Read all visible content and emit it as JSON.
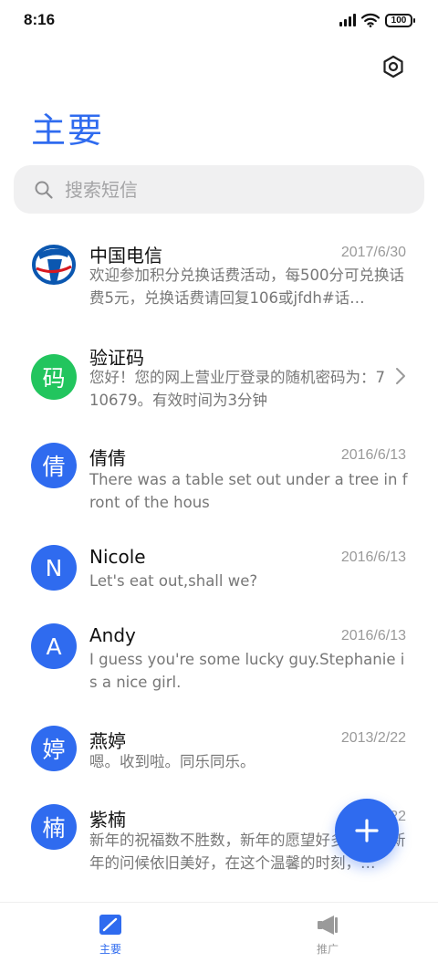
{
  "status_bar": {
    "time": "8:16",
    "battery": "100"
  },
  "header": {
    "title": "主要"
  },
  "search": {
    "placeholder": "搜索短信"
  },
  "conversations": [
    {
      "name": "中国电信",
      "date": "2017/6/30",
      "preview": "欢迎参加积分兑换话费活动，每500分可兑换话费5元，兑换话费请回复106或jfdh#话…",
      "avatar_text": "",
      "avatar_icon": "china-telecom-logo"
    },
    {
      "name": "验证码",
      "date": "",
      "preview": "您好！您的网上营业厅登录的随机密码为：710679。有效时间为3分钟",
      "avatar_text": "码"
    },
    {
      "name": "倩倩",
      "date": "2016/6/13",
      "preview": "There was a table set out under a tree in front of the hous",
      "avatar_text": "倩"
    },
    {
      "name": "Nicole",
      "date": "2016/6/13",
      "preview": "Let's eat out,shall we?",
      "avatar_text": "N"
    },
    {
      "name": "Andy",
      "date": "2016/6/13",
      "preview": "I guess you're some lucky guy.Stephanie is a nice girl.",
      "avatar_text": "A"
    },
    {
      "name": "燕婷",
      "date": "2013/2/22",
      "preview": "嗯。收到啦。同乐同乐。",
      "avatar_text": "婷"
    },
    {
      "name": "紫楠",
      "date": "2013/2/22",
      "preview": "新年的祝福数不胜数，新年的愿望好多好多，新年的问候依旧美好，在这个温馨的时刻，…",
      "avatar_text": "楠"
    }
  ],
  "bottom_nav": {
    "tabs": [
      {
        "label": "主要",
        "icon": "compose-icon",
        "active": true
      },
      {
        "label": "推广",
        "icon": "megaphone-icon",
        "active": false
      }
    ]
  },
  "colors": {
    "accent": "#2f6bef",
    "verify_avatar": "#22c55e"
  }
}
